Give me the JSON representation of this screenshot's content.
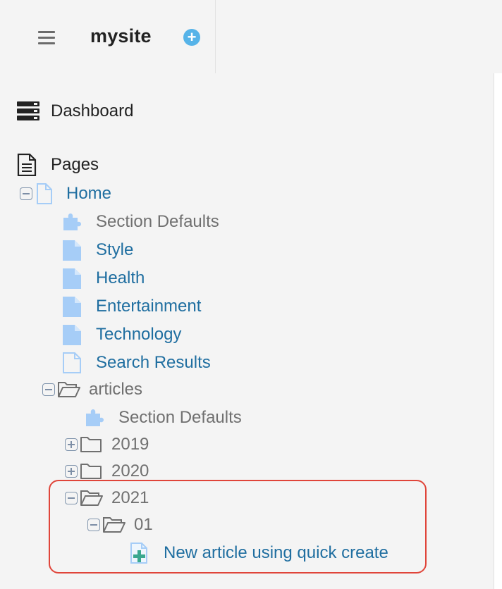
{
  "header": {
    "site_name": "mysite",
    "add_site_glyph": "+",
    "menu_icon": "hamburger-icon",
    "add_icon": "plus-circle-icon"
  },
  "nav": {
    "dashboard": "Dashboard",
    "pages": "Pages"
  },
  "tree": {
    "home": "Home",
    "home_section_defaults": "Section Defaults",
    "style": "Style",
    "health": "Health",
    "entertainment": "Entertainment",
    "technology": "Technology",
    "search_results": "Search Results",
    "articles": "articles",
    "articles_section_defaults": "Section Defaults",
    "y2019": "2019",
    "y2020": "2020",
    "y2021": "2021",
    "m01": "01",
    "new_article": "New article using quick create"
  },
  "colors": {
    "link": "#1f6ea0",
    "muted": "#707070",
    "page_icon_fill": "#a6cdf7",
    "highlight": "#e0453a",
    "accent": "#56b3e8"
  }
}
